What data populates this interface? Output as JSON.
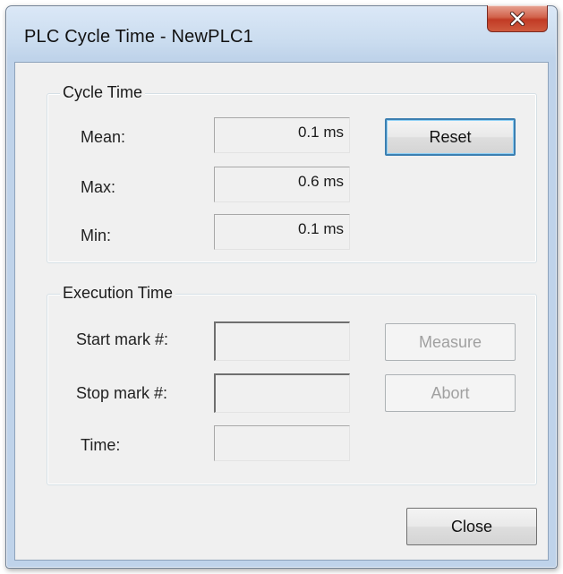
{
  "window": {
    "title": "PLC Cycle Time - NewPLC1",
    "close_glyph": "x",
    "close_icon": "close-icon"
  },
  "cycle_time": {
    "group_title": "Cycle Time",
    "mean_label": "Mean:",
    "mean_value": "0.1 ms",
    "max_label": "Max:",
    "max_value": "0.6 ms",
    "min_label": "Min:",
    "min_value": "0.1 ms",
    "reset_label": "Reset"
  },
  "execution_time": {
    "group_title": "Execution Time",
    "start_label": "Start mark #:",
    "start_value": "",
    "stop_label": "Stop mark #:",
    "stop_value": "",
    "time_label": "Time:",
    "time_value": "",
    "measure_label": "Measure",
    "abort_label": "Abort"
  },
  "footer": {
    "close_label": "Close"
  },
  "colors": {
    "title_bar": "#cadcef",
    "close_button": "#c13b25",
    "client_background": "#f0f0f0",
    "disabled_text": "#a0a0a0",
    "default_button_border": "#3c7fb1"
  }
}
